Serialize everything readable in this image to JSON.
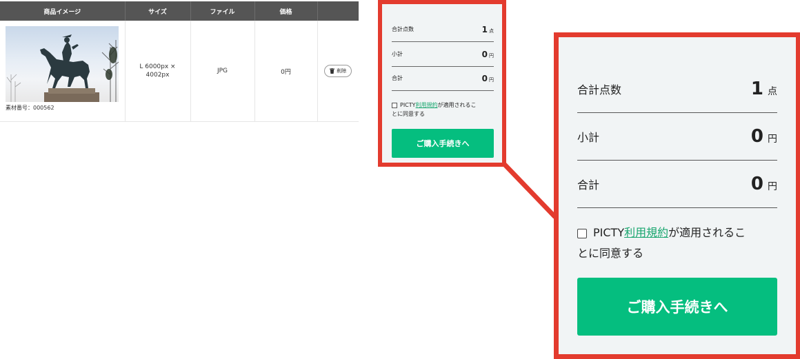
{
  "cart_table": {
    "headers": [
      "商品イメージ",
      "サイズ",
      "ファイル",
      "価格",
      ""
    ],
    "rows": [
      {
        "asset_id": "素材番号：000562",
        "size_line1": "L 6000px ×",
        "size_line2": "4002px",
        "file": "JPG",
        "price": "0円",
        "delete_label": "削除"
      }
    ]
  },
  "summary": {
    "count_label": "合計点数",
    "count_value": "1",
    "count_unit": "点",
    "subtotal_label": "小計",
    "subtotal_value": "0",
    "subtotal_unit": "円",
    "total_label": "合計",
    "total_value": "0",
    "total_unit": "円",
    "agree_prefix": "PICTY",
    "agree_link": "利用規約",
    "agree_suffix_small": "が適用されるこ",
    "agree_line2_small": "とに同意する",
    "agree_suffix_large": "が適用されるこ",
    "agree_line2_large": "とに同意する",
    "checkout_label": "ご購入手続きへ"
  },
  "colors": {
    "highlight": "#e33b2e",
    "accent": "#05be7f",
    "link": "#19a66f",
    "header": "#555555"
  }
}
